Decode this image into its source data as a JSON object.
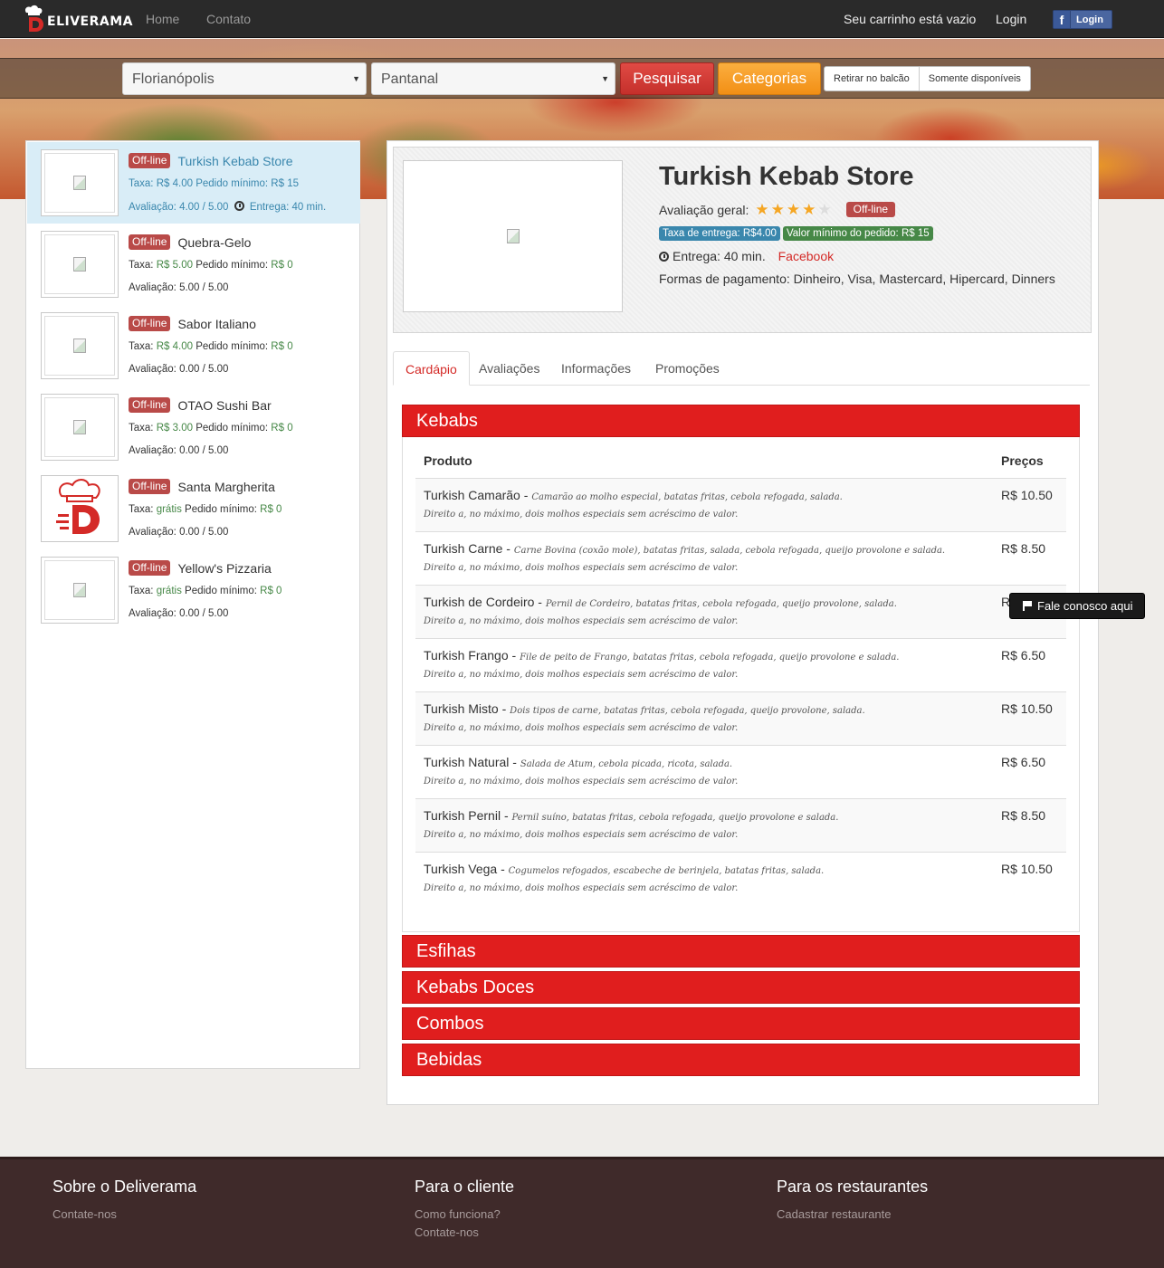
{
  "nav": {
    "brand": "ELIVERAMA",
    "home": "Home",
    "contact": "Contato",
    "cart": "Seu carrinho está vazio",
    "login": "Login",
    "fb_login": "Login"
  },
  "search": {
    "city": "Florianópolis",
    "neighborhood": "Pantanal",
    "search_button": "Pesquisar",
    "categories_button": "Categorias",
    "pickup_toggle": "Retirar no balcão",
    "available_toggle": "Somente disponíveis"
  },
  "sidebar": {
    "restaurants": [
      {
        "status": "Off-line",
        "name": "Turkish Kebab Store",
        "fee_label": "Taxa:",
        "fee": "R$ 4.00",
        "min_label": "Pedido mínimo:",
        "min": "R$ 15",
        "rating_label": "Avaliação:",
        "rating": "4.00 / 5.00",
        "delivery_label": "Entrega:",
        "delivery": "40 min."
      },
      {
        "status": "Off-line",
        "name": "Quebra-Gelo",
        "fee_label": "Taxa:",
        "fee": "R$ 5.00",
        "min_label": "Pedido mínimo:",
        "min": "R$ 0",
        "rating_label": "Avaliação:",
        "rating": "5.00 / 5.00"
      },
      {
        "status": "Off-line",
        "name": "Sabor Italiano",
        "fee_label": "Taxa:",
        "fee": "R$ 4.00",
        "min_label": "Pedido mínimo:",
        "min": "R$ 0",
        "rating_label": "Avaliação:",
        "rating": "0.00 / 5.00"
      },
      {
        "status": "Off-line",
        "name": "OTAO Sushi Bar",
        "fee_label": "Taxa:",
        "fee": "R$ 3.00",
        "min_label": "Pedido mínimo:",
        "min": "R$ 0",
        "rating_label": "Avaliação:",
        "rating": "0.00 / 5.00"
      },
      {
        "status": "Off-line",
        "name": "Santa Margherita",
        "fee_label": "Taxa:",
        "fee": "grátis",
        "min_label": "Pedido mínimo:",
        "min": "R$ 0",
        "rating_label": "Avaliação:",
        "rating": "0.00 / 5.00"
      },
      {
        "status": "Off-line",
        "name": "Yellow's Pizzaria",
        "fee_label": "Taxa:",
        "fee": "grátis",
        "min_label": "Pedido mínimo:",
        "min": "R$ 0",
        "rating_label": "Avaliação:",
        "rating": "0.00 / 5.00"
      }
    ]
  },
  "store": {
    "title": "Turkish Kebab Store",
    "rating_label": "Avaliação geral:",
    "stars_filled": 4,
    "stars_total": 5,
    "status": "Off-line",
    "delivery_fee_badge": "Taxa de entrega: R$4.00",
    "min_order_badge": "Valor mínimo do pedido: R$ 15",
    "delivery_time": "Entrega: 40 min.",
    "facebook_link": "Facebook",
    "payment_label": "Formas de pagamento:",
    "payment_methods": "Dinheiro, Visa, Mastercard, Hipercard, Dinners"
  },
  "tabs": [
    "Cardápio",
    "Avaliações",
    "Informações",
    "Promoções"
  ],
  "menu": {
    "categories": [
      "Kebabs",
      "Esfihas",
      "Kebabs Doces",
      "Combos",
      "Bebidas"
    ],
    "col_product": "Produto",
    "col_price": "Preços",
    "products": [
      {
        "name": "Turkish Camarão",
        "desc": "Camarão ao molho especial, batatas fritas, cebola refogada, salada.",
        "note": "Direito a, no máximo, dois molhos especiais sem acréscimo de valor.",
        "price": "R$ 10.50"
      },
      {
        "name": "Turkish Carne",
        "desc": "Carne Bovina (coxão mole), batatas fritas, salada, cebola refogada, queijo provolone e salada.",
        "note": "Direito a, no máximo, dois molhos especiais sem acréscimo de valor.",
        "price": "R$ 8.50"
      },
      {
        "name": "Turkish de Cordeiro",
        "desc": "Pernil de Cordeiro, batatas fritas, cebola refogada, queijo provolone, salada.",
        "note": "Direito a, no máximo, dois molhos especiais sem acréscimo de valor.",
        "price": "R"
      },
      {
        "name": "Turkish Frango",
        "desc": "File de peito de Frango, batatas fritas, cebola refogada, queijo provolone e salada.",
        "note": "Direito a, no máximo, dois molhos especiais sem acréscimo de valor.",
        "price": "R$ 6.50"
      },
      {
        "name": "Turkish Misto",
        "desc": "Dois tipos de carne, batatas fritas, cebola refogada, queijo provolone, salada.",
        "note": "Direito a, no máximo, dois molhos especiais sem acréscimo de valor.",
        "price": "R$ 10.50"
      },
      {
        "name": "Turkish Natural",
        "desc": "Salada de Atum, cebola picada, ricota, salada.",
        "note": "Direito a, no máximo, dois molhos especiais sem acréscimo de valor.",
        "price": "R$ 6.50"
      },
      {
        "name": "Turkish Pernil",
        "desc": "Pernil suíno, batatas fritas, cebola refogada, queijo provolone e salada.",
        "note": "Direito a, no máximo, dois molhos especiais sem acréscimo de valor.",
        "price": "R$ 8.50"
      },
      {
        "name": "Turkish Vega",
        "desc": "Cogumelos refogados, escabeche de berinjela, batatas fritas, salada.",
        "note": "Direito a, no máximo, dois molhos especiais sem acréscimo de valor.",
        "price": "R$ 10.50"
      }
    ]
  },
  "contact_widget": "Fale conosco aqui",
  "footer": {
    "about": {
      "title": "Sobre o Deliverama",
      "links": [
        "Contate-nos"
      ]
    },
    "customer": {
      "title": "Para o cliente",
      "links": [
        "Como funciona?",
        "Contate-nos"
      ]
    },
    "restaurants": {
      "title": "Para os restaurantes",
      "links": [
        "Cadastrar restaurante"
      ]
    }
  },
  "colors": {
    "brand_red": "#e01e1e",
    "accent_orange": "#f5a623",
    "link_blue": "#3a87ad",
    "success_green": "#468847",
    "footer_bg": "#3f2a2a"
  }
}
